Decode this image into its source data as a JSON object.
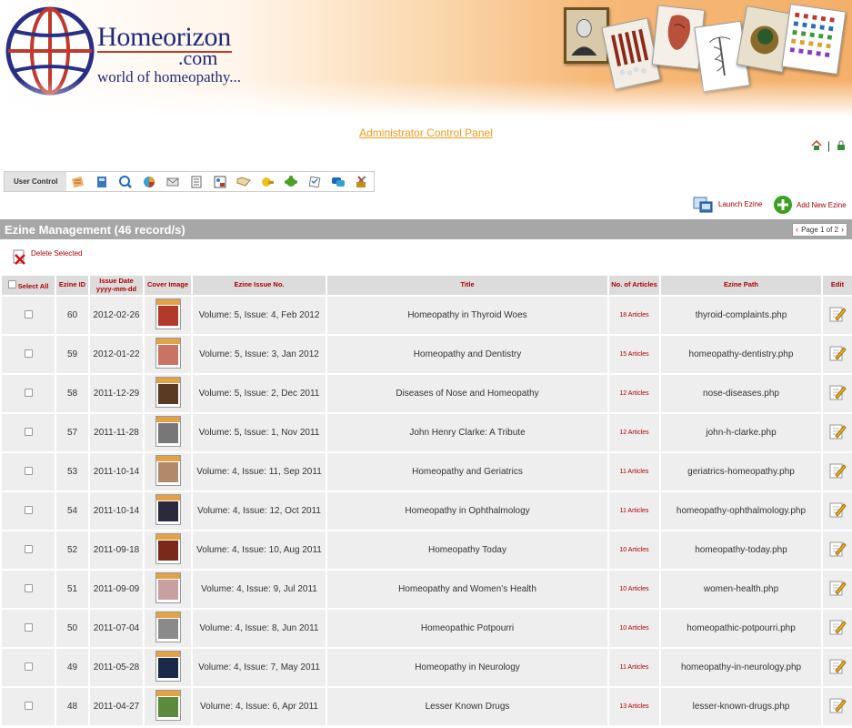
{
  "brand": {
    "name": "Homeorizon",
    "domain": ".com",
    "tagline": "world of homeopathy..."
  },
  "panel_link": "Administrator Control Panel",
  "top_separator": "|",
  "toolbar": {
    "label": "User Control",
    "icons": [
      "notes-icon",
      "book-icon",
      "search-doc-icon",
      "pie-chart-icon",
      "mail-icon",
      "list-icon",
      "users-table-icon",
      "folder-icon",
      "lock-key-icon",
      "puzzle-icon",
      "survey-icon",
      "chat-icon",
      "tools-icon"
    ]
  },
  "actions": {
    "launch": "Launch Ezine",
    "add_new": "Add New Ezine",
    "delete_selected": "Delete Selected"
  },
  "section": {
    "title": "Ezine Management (46 record/s)",
    "pager": "Page 1 of 2"
  },
  "columns": {
    "select_all": "Select All",
    "ezine_id": "Ezine ID",
    "issue_date_1": "Issue Date",
    "issue_date_2": "yyyy-mm-dd",
    "cover": "Cover Image",
    "issue_no": "Ezine Issue No.",
    "title": "Title",
    "articles": "No. of Articles",
    "path": "Ezine Path",
    "edit": "Edit"
  },
  "rows": [
    {
      "id": "60",
      "date": "2012-02-26",
      "issue": "Volume: 5, Issue: 4, Feb 2012",
      "title": "Homeopathy in Thyroid Woes",
      "articles": "18 Articles",
      "path": "thyroid-complaints.php",
      "cover_color": "#b23a2a"
    },
    {
      "id": "59",
      "date": "2012-01-22",
      "issue": "Volume: 5, Issue: 3, Jan 2012",
      "title": "Homeopathy and Dentistry",
      "articles": "15 Articles",
      "path": "homeopathy-dentistry.php",
      "cover_color": "#c97462"
    },
    {
      "id": "58",
      "date": "2011-12-29",
      "issue": "Volume: 5, Issue: 2, Dec 2011",
      "title": "Diseases of Nose and Homeopathy",
      "articles": "12 Articles",
      "path": "nose-diseases.php",
      "cover_color": "#5a3a22"
    },
    {
      "id": "57",
      "date": "2011-11-28",
      "issue": "Volume: 5, Issue: 1, Nov 2011",
      "title": "John Henry Clarke: A Tribute",
      "articles": "12 Articles",
      "path": "john-h-clarke.php",
      "cover_color": "#777777"
    },
    {
      "id": "53",
      "date": "2011-10-14",
      "issue": "Volume: 4, Issue: 11, Sep 2011",
      "title": "Homeopathy and Geriatrics",
      "articles": "11 Articles",
      "path": "geriatrics-homeopathy.php",
      "cover_color": "#b08a6a"
    },
    {
      "id": "54",
      "date": "2011-10-14",
      "issue": "Volume: 4, Issue: 12, Oct 2011",
      "title": "Homeopathy in Ophthalmology",
      "articles": "11 Articles",
      "path": "homeopathy-ophthalmology.php",
      "cover_color": "#2a2a3a"
    },
    {
      "id": "52",
      "date": "2011-09-18",
      "issue": "Volume: 4, Issue: 10, Aug 2011",
      "title": "Homeopathy Today",
      "articles": "10 Articles",
      "path": "homeopathy-today.php",
      "cover_color": "#7a2a1a"
    },
    {
      "id": "51",
      "date": "2011-09-09",
      "issue": "Volume: 4, Issue: 9, Jul 2011",
      "title": "Homeopathy and Women's Health",
      "articles": "10 Articles",
      "path": "women-health.php",
      "cover_color": "#c9a0a0"
    },
    {
      "id": "50",
      "date": "2011-07-04",
      "issue": "Volume: 4, Issue: 8, Jun 2011",
      "title": "Homeopathic Potpourri",
      "articles": "10 Articles",
      "path": "homeopathic-potpourri.php",
      "cover_color": "#8a8a8a"
    },
    {
      "id": "49",
      "date": "2011-05-28",
      "issue": "Volume: 4, Issue: 7, May 2011",
      "title": "Homeopathy in Neurology",
      "articles": "11 Articles",
      "path": "homeopathy-in-neurology.php",
      "cover_color": "#1a2a4a"
    },
    {
      "id": "48",
      "date": "2011-04-27",
      "issue": "Volume: 4, Issue: 6, Apr 2011",
      "title": "Lesser Known Drugs",
      "articles": "13 Articles",
      "path": "lesser-known-drugs.php",
      "cover_color": "#5a8a3a"
    }
  ]
}
